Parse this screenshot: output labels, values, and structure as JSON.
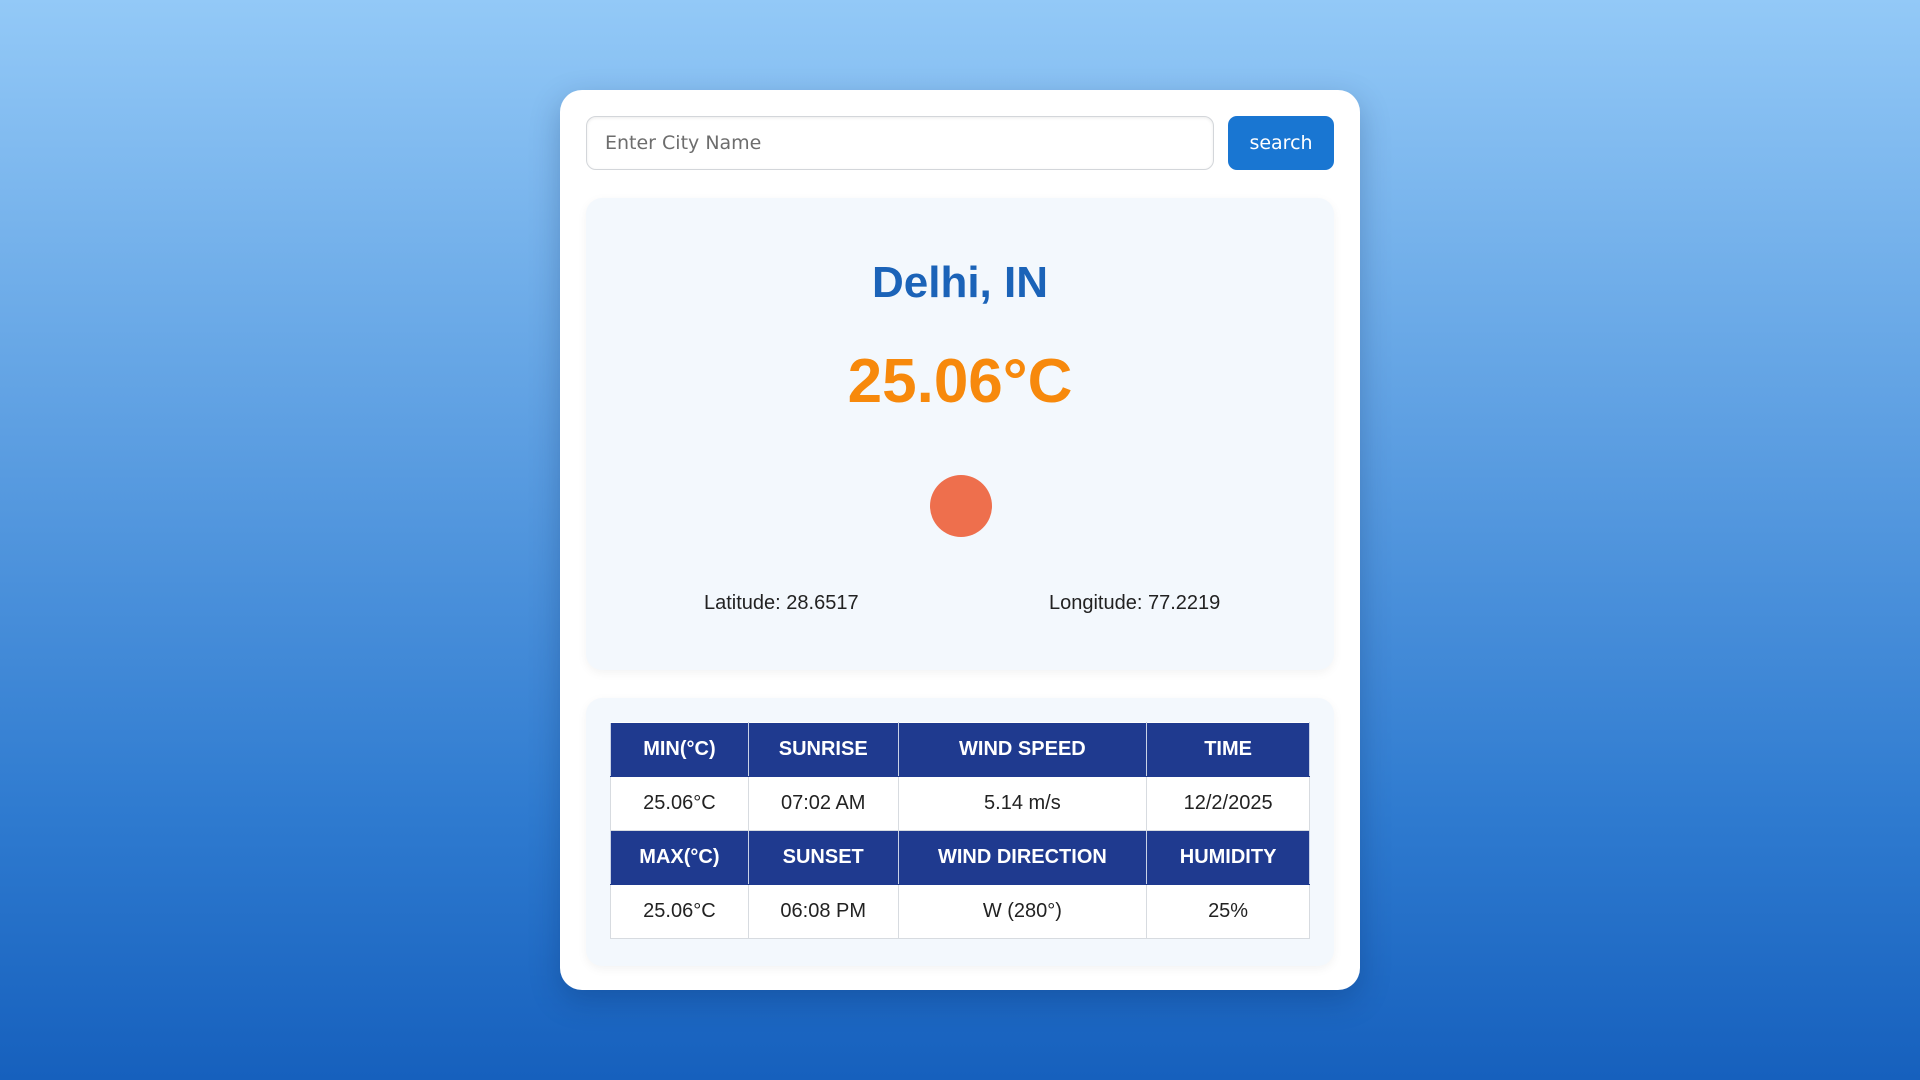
{
  "search": {
    "placeholder": "Enter City Name",
    "button_label": "search"
  },
  "weather": {
    "city": "Delhi, IN",
    "temperature": "25.06°C",
    "icon": "sun-icon",
    "latitude_text": "Latitude: 28.6517",
    "longitude_text": "Longitude: 77.2219"
  },
  "details": {
    "row1_headers": [
      "MIN(°C)",
      "SUNRISE",
      "WIND SPEED",
      "TIME"
    ],
    "row1_values": [
      "25.06°C",
      "07:02 AM",
      "5.14 m/s",
      "12/2/2025"
    ],
    "row2_headers": [
      "MAX(°C)",
      "SUNSET",
      "WIND DIRECTION",
      "HUMIDITY"
    ],
    "row2_values": [
      "25.06°C",
      "06:08 PM",
      "W (280°)",
      "25%"
    ]
  },
  "colors": {
    "accent": "#1976d2",
    "city": "#1b63b8",
    "temperature": "#f7890c",
    "sun": "#ee6f4d",
    "table_header": "#1f3a8f"
  }
}
